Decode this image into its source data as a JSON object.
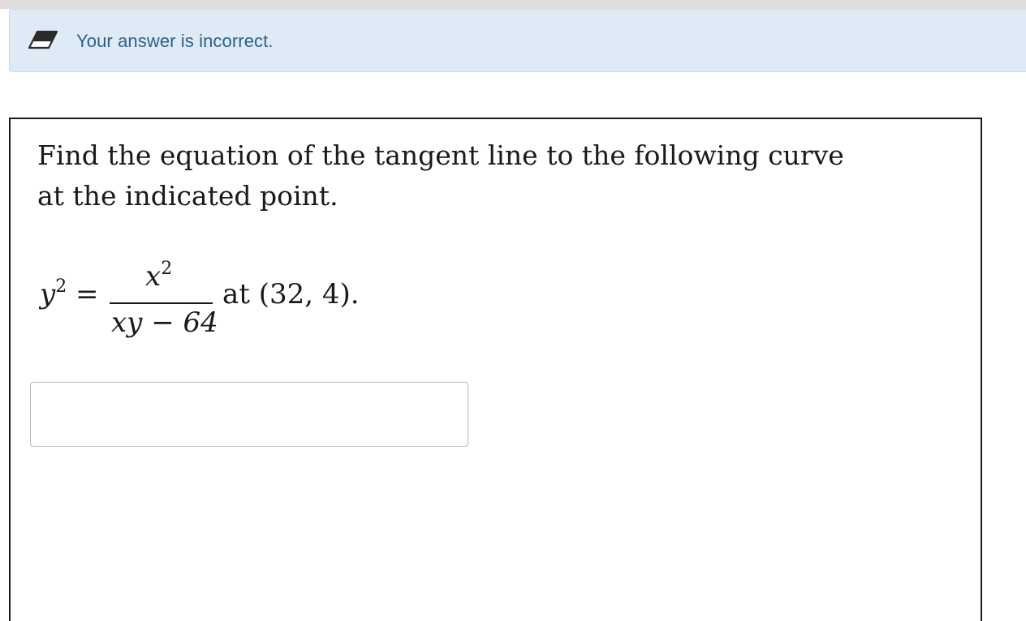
{
  "feedback": {
    "icon": "eraser-icon",
    "message": "Your answer is incorrect.",
    "text_color": "#2e5f8a",
    "background_color": "#deebf6"
  },
  "question": {
    "prompt_line1": "Find the equation of the tangent line to the following curve",
    "prompt_line2": "at the indicated point.",
    "equation": {
      "lhs_base": "y",
      "lhs_exponent": "2",
      "equals": "=",
      "numerator_base": "x",
      "numerator_exponent": "2",
      "denominator": "xy − 64",
      "tail": "at (32, 4)."
    }
  },
  "answer": {
    "value": "",
    "placeholder": ""
  }
}
